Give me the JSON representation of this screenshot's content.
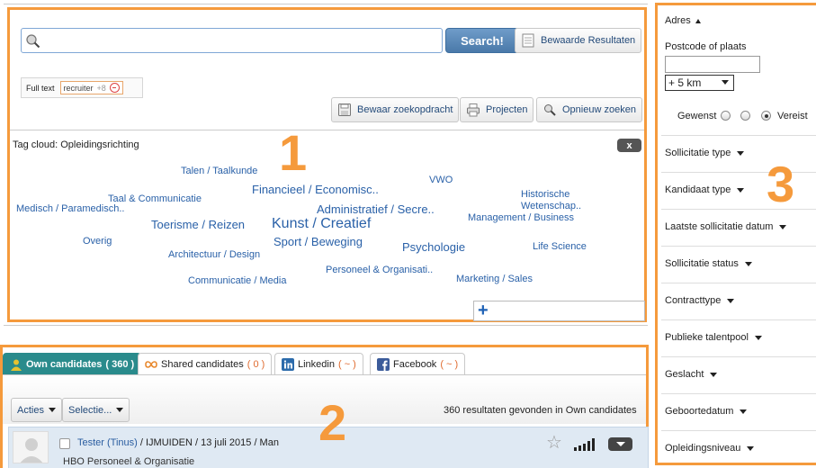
{
  "search": {
    "placeholder": "",
    "value": "",
    "search_button": "Search!",
    "saved_results_button": "Bewaarde Resultaten"
  },
  "filters": {
    "label": "Full text",
    "chip_text": "recruiter",
    "chip_count": "+8"
  },
  "actions": {
    "save_query": "Bewaar zoekopdracht",
    "projects": "Projecten",
    "search_again": "Opnieuw zoeken"
  },
  "tag_cloud": {
    "title": "Tag cloud: Opleidingsrichting",
    "close_label": "x",
    "add_label": "+",
    "tags": [
      "Talen / Taalkunde",
      "VWO",
      "Financieel / Economisc..",
      "Historische Wetenschap..",
      "Taal & Communicatie",
      "Medisch / Paramedisch..",
      "Administratief / Secre..",
      "Management / Business",
      "Toerisme / Reizen",
      "Kunst / Creatief",
      "Overig",
      "Sport / Beweging",
      "Psychologie",
      "Life Science",
      "Architectuur / Design",
      "Personeel & Organisati..",
      "Communicatie / Media",
      "Marketing / Sales"
    ]
  },
  "annotations": {
    "panel1": "1",
    "panel2": "2",
    "panel3": "3"
  },
  "candidates": {
    "tabs": [
      {
        "label": "Own candidates",
        "count": "( 360 )",
        "icon": "person-icon"
      },
      {
        "label": "Shared candidates",
        "count": "( 0 )",
        "icon": "infinity-icon"
      },
      {
        "label": "Linkedin",
        "count": "( ~ )",
        "icon": "linkedin-icon"
      },
      {
        "label": "Facebook",
        "count": "( ~ )",
        "icon": "facebook-icon"
      }
    ],
    "actions_label": "Acties",
    "selection_label": "Selectie...",
    "results_text": "360 resultaten gevonden in Own candidates",
    "rows": [
      {
        "name": "Tester (Tinus)",
        "details": "/ IJMUIDEN  / 13 juli 2015 / Man",
        "education": "HBO Personeel & Organisatie"
      }
    ]
  },
  "sidebar": {
    "address_label": "Adres",
    "postcode_label": "Postcode of plaats",
    "postcode_value": "",
    "distance": "+ 5 km",
    "radio_left": "Gewenst",
    "radio_right": "Vereist",
    "sections": [
      "Sollicitatie type",
      "Kandidaat type",
      "Laatste sollicitatie datum",
      "Sollicitatie status",
      "Contracttype",
      "Publieke talentpool",
      "Geslacht",
      "Geboortedatum",
      "Opleidingsniveau"
    ]
  },
  "colors": {
    "annotation_orange": "#f59a3c",
    "link_blue": "#2a61a8",
    "active_tab": "#2a8b8c"
  }
}
